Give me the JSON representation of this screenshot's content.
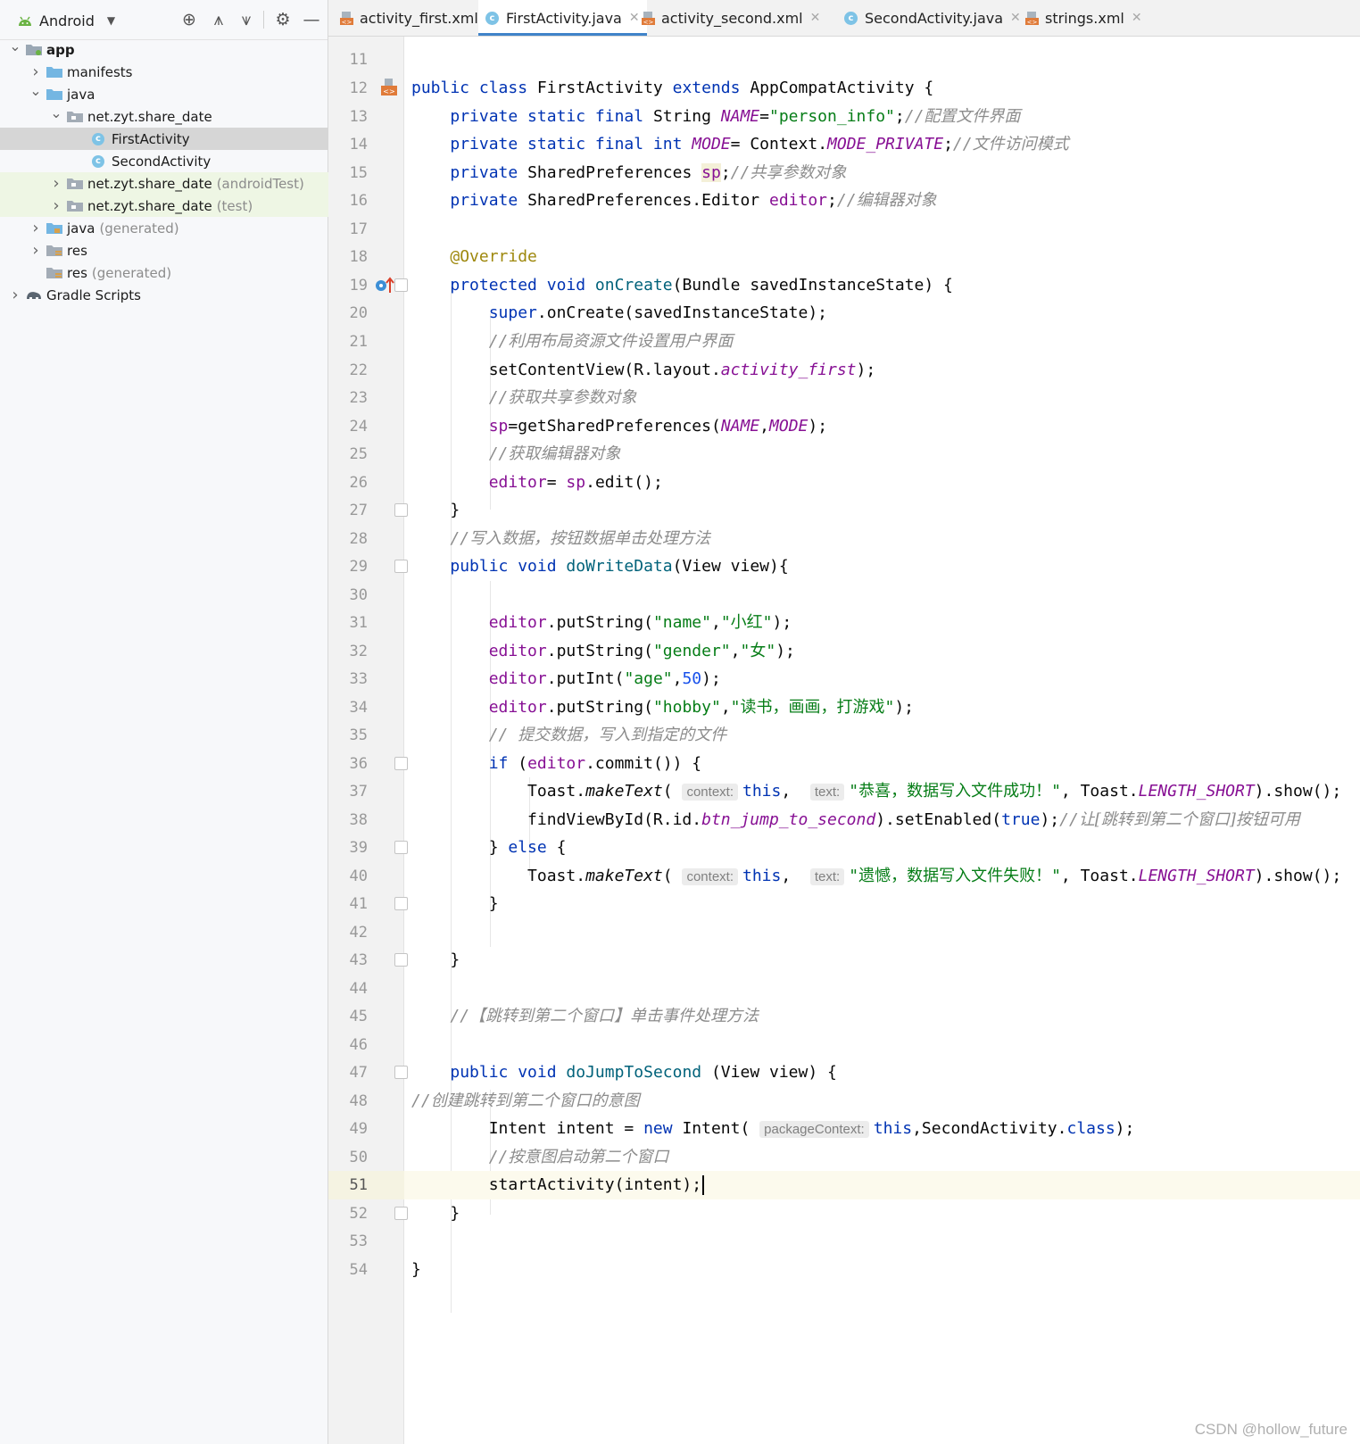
{
  "project_panel": {
    "view_selector": "Android",
    "tree": [
      {
        "label": "app",
        "suffix": ""
      },
      {
        "label": "manifests",
        "suffix": ""
      },
      {
        "label": "java",
        "suffix": ""
      },
      {
        "label": "net.zyt.share_date",
        "suffix": ""
      },
      {
        "label": "FirstActivity",
        "suffix": ""
      },
      {
        "label": "SecondActivity",
        "suffix": ""
      },
      {
        "label": "net.zyt.share_date",
        "suffix": "(androidTest)"
      },
      {
        "label": "net.zyt.share_date",
        "suffix": "(test)"
      },
      {
        "label": "java",
        "suffix": "(generated)"
      },
      {
        "label": "res",
        "suffix": ""
      },
      {
        "label": "res",
        "suffix": "(generated)"
      },
      {
        "label": "Gradle Scripts",
        "suffix": ""
      }
    ]
  },
  "tabs": [
    {
      "label": "activity_first.xml",
      "active": false
    },
    {
      "label": "FirstActivity.java",
      "active": true
    },
    {
      "label": "activity_second.xml",
      "active": false
    },
    {
      "label": "SecondActivity.java",
      "active": false
    },
    {
      "label": "strings.xml",
      "active": false
    }
  ],
  "editor": {
    "line_numbers": [
      "11",
      "12",
      "13",
      "14",
      "15",
      "16",
      "17",
      "18",
      "19",
      "20",
      "21",
      "22",
      "23",
      "24",
      "25",
      "26",
      "27",
      "28",
      "29",
      "30",
      "31",
      "32",
      "33",
      "34",
      "35",
      "36",
      "37",
      "38",
      "39",
      "40",
      "41",
      "42",
      "43",
      "44",
      "45",
      "46",
      "47",
      "48",
      "49",
      "50",
      "51",
      "52",
      "53",
      "54"
    ],
    "code_text": {
      "l12": "public class FirstActivity extends AppCompatActivity {",
      "l13": "    private static final String NAME=\"person_info\";//配置文件界面",
      "l14": "    private static final int MODE= Context.MODE_PRIVATE;//文件访问模式",
      "l15": "    private SharedPreferences sp;//共享参数对象",
      "l16": "    private SharedPreferences.Editor editor;//编辑器对象",
      "l18": "    @Override",
      "l19": "    protected void onCreate(Bundle savedInstanceState) {",
      "l20": "        super.onCreate(savedInstanceState);",
      "l21": "        //利用布局资源文件设置用户界面",
      "l22": "        setContentView(R.layout.activity_first);",
      "l23": "        //获取共享参数对象",
      "l24": "        sp=getSharedPreferences(NAME,MODE);",
      "l25": "        //获取编辑器对象",
      "l26": "        editor= sp.edit();",
      "l27": "    }",
      "l28": "    //写入数据，按钮数据单击处理方法",
      "l29": "    public void doWriteData(View view){",
      "l31": "        editor.putString(\"name\",\"小红\");",
      "l32": "        editor.putString(\"gender\",\"女\");",
      "l33": "        editor.putInt(\"age\",50);",
      "l34": "        editor.putString(\"hobby\",\"读书，画画，打游戏\");",
      "l35": "        // 提交数据，写入到指定的文件",
      "l36": "        if (editor.commit()) {",
      "l37": "            Toast.makeText( context: this,  text: \"恭喜，数据写入文件成功！\", Toast.LENGTH_SHORT).show();",
      "l38": "            findViewById(R.id.btn_jump_to_second).setEnabled(true);//让[跳转到第二个窗口]按钮可用",
      "l39": "        } else {",
      "l40": "            Toast.makeText( context: this,  text: \"遗憾，数据写入文件失败！\", Toast.LENGTH_SHORT).show();",
      "l41": "        }",
      "l43": "    }",
      "l45": "    //【跳转到第二个窗口】单击事件处理方法",
      "l47": "    public void doJumpToSecond (View view) {",
      "l48": "//创建跳转到第二个窗口的意图",
      "l49": "        Intent intent = new Intent( packageContext: this,SecondActivity.class);",
      "l50": "        //按意图启动第二个窗口",
      "l51": "        startActivity(intent);",
      "l52": "    }",
      "l54": "}"
    },
    "parameter_hints": {
      "context": "context:",
      "text": "text:",
      "packageContext": "packageContext:"
    }
  },
  "watermark": "CSDN @hollow_future",
  "colors": {
    "keyword": "#0033b3",
    "string": "#067d17",
    "comment": "#8c8c8c",
    "constant": "#871094",
    "annotation": "#9e880d",
    "number": "#1750eb",
    "active_tab_underline": "#4083c9"
  }
}
